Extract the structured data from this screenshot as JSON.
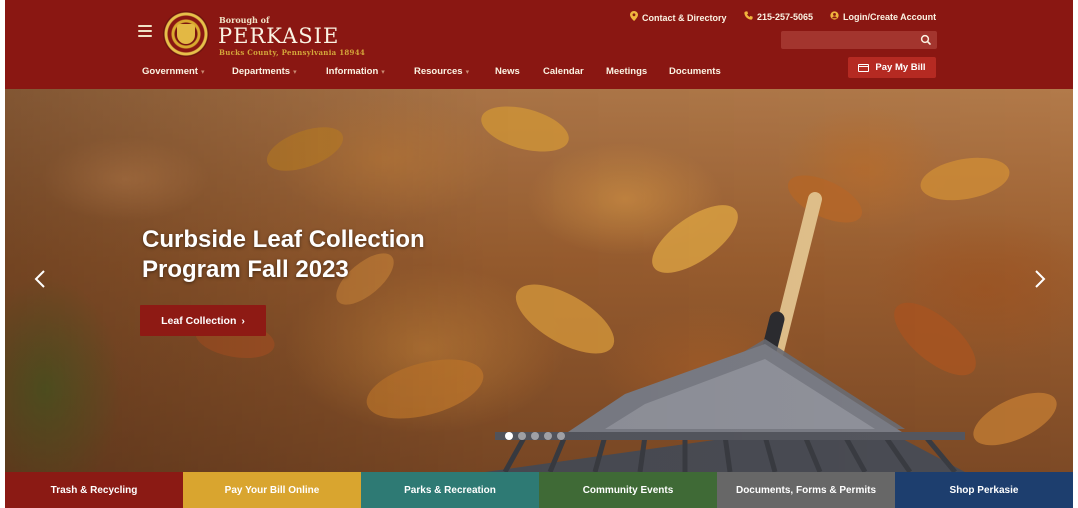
{
  "header": {
    "brand_top": "Borough of",
    "brand_name": "PERKASIE",
    "brand_sub": "Bucks County, Pennsylvania 18944",
    "utility": {
      "contact": "Contact & Directory",
      "phone": "215-257-5065",
      "login": "Login/Create Account"
    },
    "search_placeholder": "",
    "nav": [
      {
        "label": "Government",
        "dropdown": true
      },
      {
        "label": "Departments",
        "dropdown": true
      },
      {
        "label": "Information",
        "dropdown": true
      },
      {
        "label": "Resources",
        "dropdown": true
      },
      {
        "label": "News",
        "dropdown": false
      },
      {
        "label": "Calendar",
        "dropdown": false
      },
      {
        "label": "Meetings",
        "dropdown": false
      },
      {
        "label": "Documents",
        "dropdown": false
      }
    ],
    "pay_button": "Pay My Bill"
  },
  "hero": {
    "title_line1": "Curbside Leaf Collection",
    "title_line2": "Program Fall 2023",
    "cta": "Leaf Collection",
    "slide_count": 5,
    "active_slide": 1
  },
  "quick_links": [
    {
      "label": "Trash & Recycling",
      "color": "#8b1a14"
    },
    {
      "label": "Pay Your Bill Online",
      "color": "#d9a52f"
    },
    {
      "label": "Parks & Recreation",
      "color": "#2e7a74"
    },
    {
      "label": "Community Events",
      "color": "#3f6a36"
    },
    {
      "label": "Documents, Forms & Permits",
      "color": "#676767"
    },
    {
      "label": "Shop Perkasie",
      "color": "#1d3e6e"
    }
  ],
  "colors": {
    "header_bg": "#8a1712",
    "accent_gold": "#f0b53d",
    "button_red": "#b52a22"
  },
  "icons": {
    "menu": "hamburger-icon",
    "contact": "map-pin-icon",
    "phone": "phone-icon",
    "login": "user-circle-icon",
    "search": "search-icon",
    "pay": "credit-card-icon",
    "prev": "chevron-left-icon",
    "next": "chevron-right-icon"
  }
}
